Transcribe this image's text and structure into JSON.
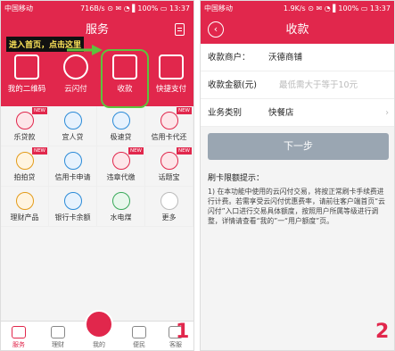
{
  "phone1": {
    "status": {
      "carrier": "中国移动",
      "right": "716B/s ⊙ ✉ ◔ ▌100% ▭ 13:37"
    },
    "title": "服务",
    "tip": "进入首页，点击这里",
    "actions": [
      {
        "label": "我的二维码",
        "icon": "qr-code-icon"
      },
      {
        "label": "云闪付",
        "icon": "pay-icon"
      },
      {
        "label": "收款",
        "icon": "pos-terminal-icon"
      },
      {
        "label": "快捷支付",
        "icon": "card-pay-icon"
      }
    ],
    "grid": [
      {
        "label": "乐贷款",
        "badge": "NEW"
      },
      {
        "label": "宜人贷",
        "badge": ""
      },
      {
        "label": "极速贷",
        "badge": ""
      },
      {
        "label": "信用卡代还",
        "badge": "NEW"
      },
      {
        "label": "拍拍贷",
        "badge": "NEW"
      },
      {
        "label": "信用卡申请",
        "badge": ""
      },
      {
        "label": "违章代缴",
        "badge": "NEW"
      },
      {
        "label": "话题宝",
        "badge": "NEW"
      },
      {
        "label": "理财产品",
        "badge": ""
      },
      {
        "label": "银行卡余额",
        "badge": ""
      },
      {
        "label": "水电煤",
        "badge": ""
      },
      {
        "label": "更多",
        "badge": ""
      }
    ],
    "nav": [
      "服务",
      "理财",
      "我的",
      "便民",
      "客服"
    ],
    "marker": "1"
  },
  "phone2": {
    "status": {
      "carrier": "中国移动",
      "right": "1.9K/s ⊙ ✉ ◔ ▌100% ▭ 13:37"
    },
    "title": "收款",
    "merchant_label": "收款商户：",
    "merchant_value": "沃德商铺",
    "amount_label": "收款金额(元)",
    "amount_placeholder": "最低需大于等于10元",
    "category_label": "业务类别",
    "category_value": "快餐店",
    "next_button": "下一步",
    "tips_title": "刷卡限额提示：",
    "tips_body": "1) 在本功能中使用的云闪付交易，将按正常刷卡手续费进行计费。若需享受云闪付优惠费率，请前往客户端首页“云闪付”入口进行交易具体额度，按照用户所属等级进行调整，详情请查看“我的”一“用户额度”页。",
    "marker": "2"
  }
}
